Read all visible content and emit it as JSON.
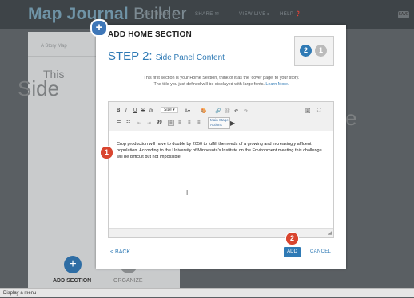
{
  "app": {
    "title_bold": "Map Journal",
    "title_rest": "Builder"
  },
  "topmenu": [
    {
      "label": "SETTINGS ⚙"
    },
    {
      "label": "SHARE ✉"
    },
    {
      "label": "VIEW LIVE ▸"
    },
    {
      "label": "HELP ❓"
    }
  ],
  "corner_button": "SAVE",
  "left_panel": {
    "subtitle": "A Story Map"
  },
  "background_text": {
    "this": "This",
    "side": "Side",
    "tail": "e"
  },
  "bottom": {
    "add_section": "ADD SECTION",
    "organize": "ORGANIZE"
  },
  "status_bar": "Display a menu",
  "modal": {
    "title": "ADD HOME SECTION",
    "step_main": "STEP 2:",
    "step_sub": "Side Panel Content",
    "step_current": "2",
    "step_next": "1",
    "description_1": "This first section is your Home Section, think of it as the 'cover page' to your story.",
    "description_2": "The title you just defined will be displayed with large fonts.",
    "learn_more": "Learn More.",
    "toolbar": {
      "row1": [
        "B",
        "I",
        "U",
        "S",
        "Ix",
        "Size ▾",
        "A▾",
        "🎨",
        "🔗",
        "⛓",
        "↶",
        "↷",
        "🖼",
        "⛶"
      ],
      "row2": [
        "☰",
        "☷",
        "⇤",
        "⇥",
        "99",
        "≡",
        "≡",
        "≡",
        "≡"
      ],
      "main_stage_actions": "Main Stage Actions"
    },
    "content": "Crop production will have to double by 2050 to fulfill the needs of a growing and increasingly affluent population. According to the University of Minnesota's Institute on the Environment meeting this challenge will be difficult but not impossible.",
    "back": "< BACK",
    "add": "ADD",
    "cancel": "CANCEL"
  },
  "badges": {
    "first": "1",
    "second": "2"
  },
  "colors": {
    "accent": "#2f7ab5",
    "badge": "#d9452f",
    "topbar": "#3e4448"
  }
}
